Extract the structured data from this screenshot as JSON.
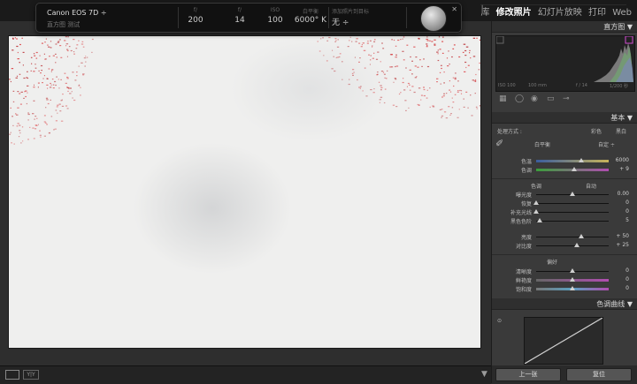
{
  "module_picker": {
    "items": [
      {
        "label": "库",
        "active": false
      },
      {
        "label": "修改照片",
        "active": true
      },
      {
        "label": "幻灯片放映",
        "active": false
      },
      {
        "label": "打印",
        "active": false
      },
      {
        "label": "Web",
        "active": false
      }
    ],
    "separator": "|"
  },
  "info_overlay": {
    "camera": "Canon EOS 7D",
    "camera_caret": "÷",
    "preset_text": "直方图 测试",
    "columns": [
      {
        "heading": "f/",
        "value": "200"
      },
      {
        "heading": "f/",
        "value": "14"
      },
      {
        "heading": "ISO",
        "value": "100"
      },
      {
        "heading": "白平衡",
        "value": "6000° K"
      },
      {
        "heading": "添加照片到目标",
        "value": "无 ÷"
      }
    ],
    "close_icon": "close-icon"
  },
  "toolbar": {
    "view_loupe_icon": "loupe-view-icon",
    "view_compare_label": "Y|Y",
    "dropdown_icon": "chevron-down-icon"
  },
  "right_panel": {
    "histogram": {
      "title": "直方图 ▼",
      "readout": [
        "ISO 100",
        "100 mm",
        "f / 14",
        "1/200 秒"
      ]
    },
    "basic": {
      "title": "基本 ▼",
      "treatment": {
        "label": "处理方式 :",
        "color": "彩色",
        "bw": "黑白"
      },
      "wb": {
        "label": "白平衡",
        "value": "自定 ÷"
      },
      "sliders_wb": [
        {
          "label": "色温",
          "value": "6000",
          "pos": 0.62
        },
        {
          "label": "色调",
          "value": "+ 9",
          "pos": 0.53
        }
      ],
      "tone": {
        "label": "色调",
        "auto": "自动"
      },
      "sliders_tone": [
        {
          "label": "曝光度",
          "value": "0.00",
          "pos": 0.5
        },
        {
          "label": "恢复",
          "value": "0",
          "pos": 0.0
        },
        {
          "label": "补充光线",
          "value": "0",
          "pos": 0.0
        },
        {
          "label": "黑色色阶",
          "value": "5",
          "pos": 0.05
        },
        {
          "label": "亮度",
          "value": "+ 50",
          "pos": 0.62
        },
        {
          "label": "对比度",
          "value": "+ 25",
          "pos": 0.56
        }
      ],
      "presence": {
        "label": "偏好"
      },
      "sliders_presence": [
        {
          "label": "清晰度",
          "value": "0",
          "pos": 0.5
        },
        {
          "label": "鲜艳度",
          "value": "0",
          "pos": 0.5
        },
        {
          "label": "饱和度",
          "value": "0",
          "pos": 0.5
        }
      ]
    },
    "tone_curve": {
      "title": "色调曲线 ▼"
    },
    "buttons": {
      "previous": "上一张",
      "reset": "复位"
    }
  }
}
